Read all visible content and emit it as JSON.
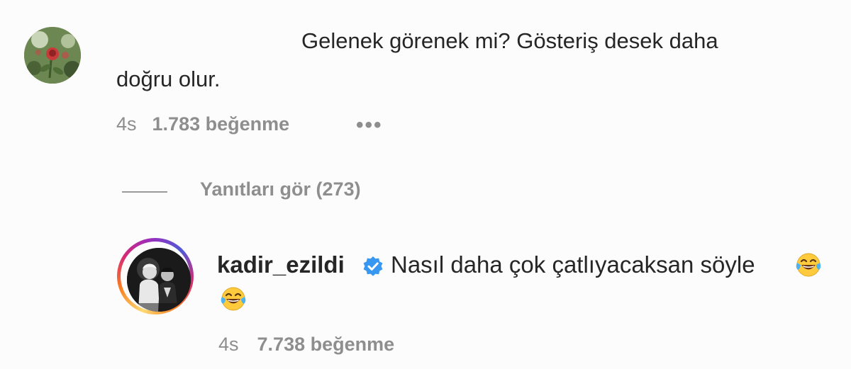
{
  "comment_1": {
    "text_line1": "Gelenek görenek mi? Gösteriş desek daha",
    "text_line2": "doğru olur.",
    "time": "4s",
    "likes": "1.783 beğenme",
    "more_icon": "ellipsis-icon"
  },
  "replies": {
    "label": "Yanıtları gör (273)"
  },
  "comment_2": {
    "username": "kadir_ezildi",
    "verified_icon": "verified-badge-icon",
    "text": "Nasıl daha çok çatlıyacaksan söyle",
    "emoji_icon": "tears-of-joy-emoji-icon",
    "time": "4s",
    "likes": "7.738 beğenme"
  },
  "colors": {
    "text": "#262626",
    "secondary": "#8e8e8e",
    "verified": "#3897f0"
  }
}
